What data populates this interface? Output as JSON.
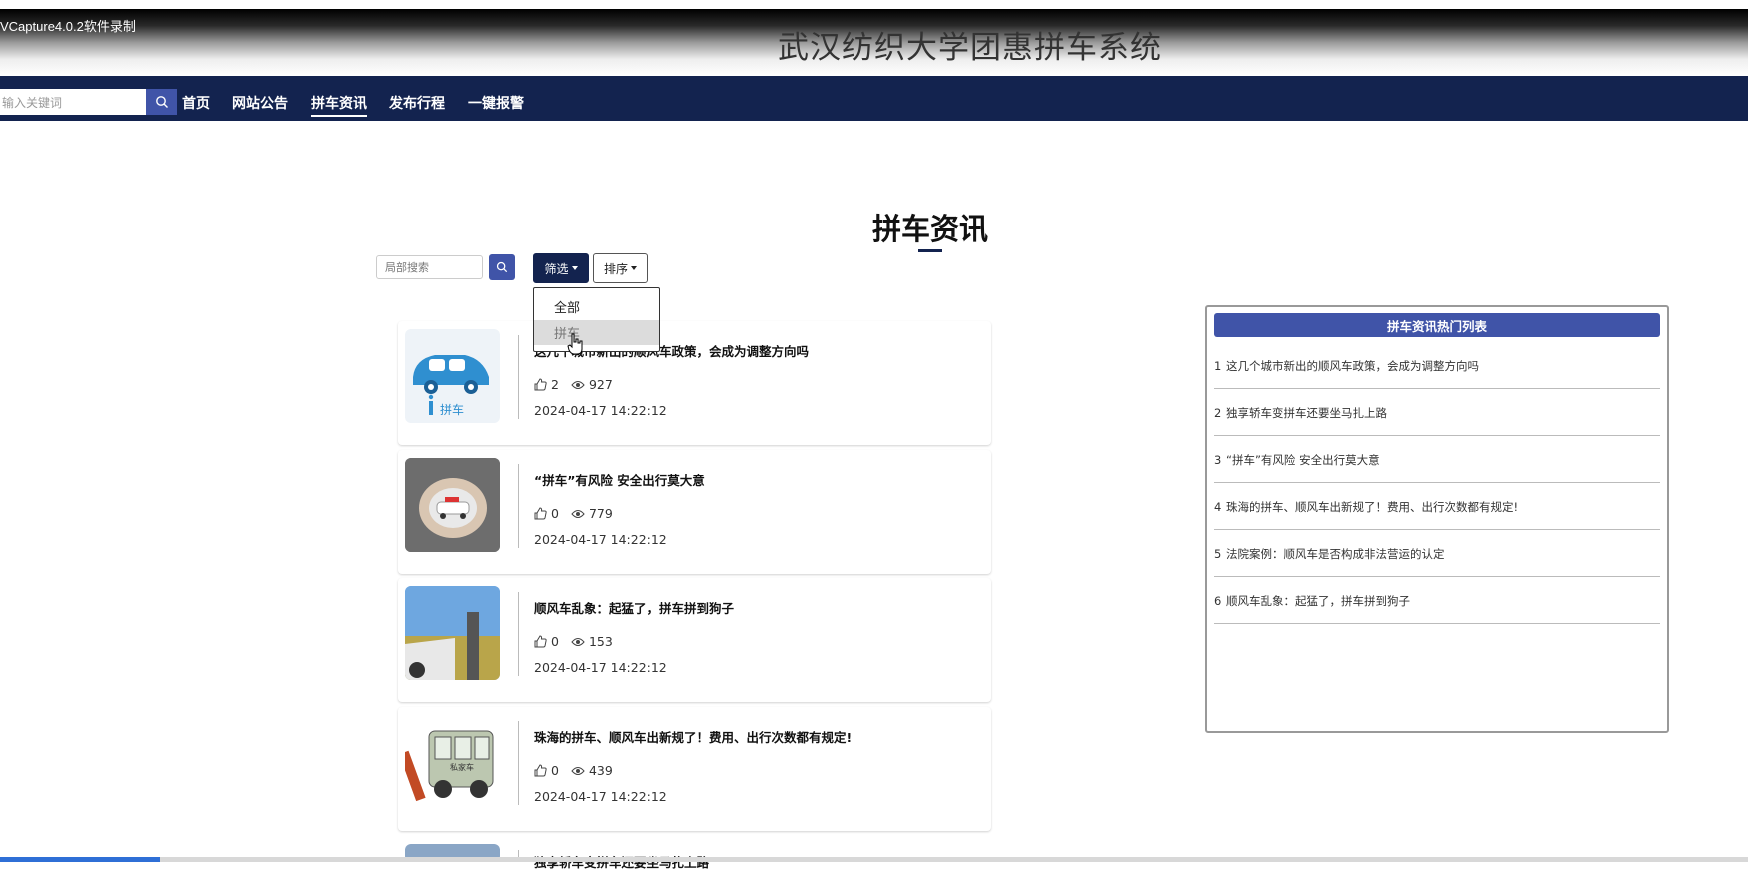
{
  "watermark": "VCapture4.0.2软件录制",
  "site_title": "武汉纺织大学团惠拼车系统",
  "nav": {
    "search_placeholder": "输入关键词",
    "items": [
      "首页",
      "网站公告",
      "拼车资讯",
      "发布行程",
      "一键报警"
    ],
    "active": "拼车资讯"
  },
  "page_heading": "拼车资讯",
  "toolbar": {
    "local_search_placeholder": "局部搜索",
    "filter_label": "筛选",
    "sort_label": "排序"
  },
  "dropdown": {
    "items": [
      "全部",
      "拼车"
    ],
    "hovered": "拼车"
  },
  "articles": [
    {
      "title": "这几个城市新出的顺风车政策，会成为调整方向吗",
      "likes": "2",
      "views": "927",
      "date": "2024-04-17 14:22:12",
      "thumb_label": "拼车"
    },
    {
      "title": "“拼车”有风险 安全出行莫大意",
      "likes": "0",
      "views": "779",
      "date": "2024-04-17 14:22:12"
    },
    {
      "title": "顺风车乱象：起猛了，拼车拼到狗子",
      "likes": "0",
      "views": "153",
      "date": "2024-04-17 14:22:12"
    },
    {
      "title": "珠海的拼车、顺风车出新规了！费用、出行次数都有规定!",
      "likes": "0",
      "views": "439",
      "date": "2024-04-17 14:22:12",
      "thumb_label": "私家车"
    },
    {
      "title": "独享轿车变拼车还要坐马扎上路"
    }
  ],
  "sidebar": {
    "title": "拼车资讯热门列表",
    "items": [
      {
        "num": "1",
        "text": "这几个城市新出的顺风车政策，会成为调整方向吗"
      },
      {
        "num": "2",
        "text": "独享轿车变拼车还要坐马扎上路"
      },
      {
        "num": "3",
        "text": "“拼车”有风险 安全出行莫大意"
      },
      {
        "num": "4",
        "text": "珠海的拼车、顺风车出新规了！费用、出行次数都有规定!"
      },
      {
        "num": "5",
        "text": "法院案例：顺风车是否构成非法营运的认定"
      },
      {
        "num": "6",
        "text": "顺风车乱象：起猛了，拼车拼到狗子"
      }
    ]
  },
  "colors": {
    "navbar": "#13234f",
    "accent": "#4054a8"
  },
  "icons": {
    "search": "search-icon",
    "like": "thumbs-up-icon",
    "views": "eye-icon",
    "cursor": "hand-pointer-icon"
  }
}
